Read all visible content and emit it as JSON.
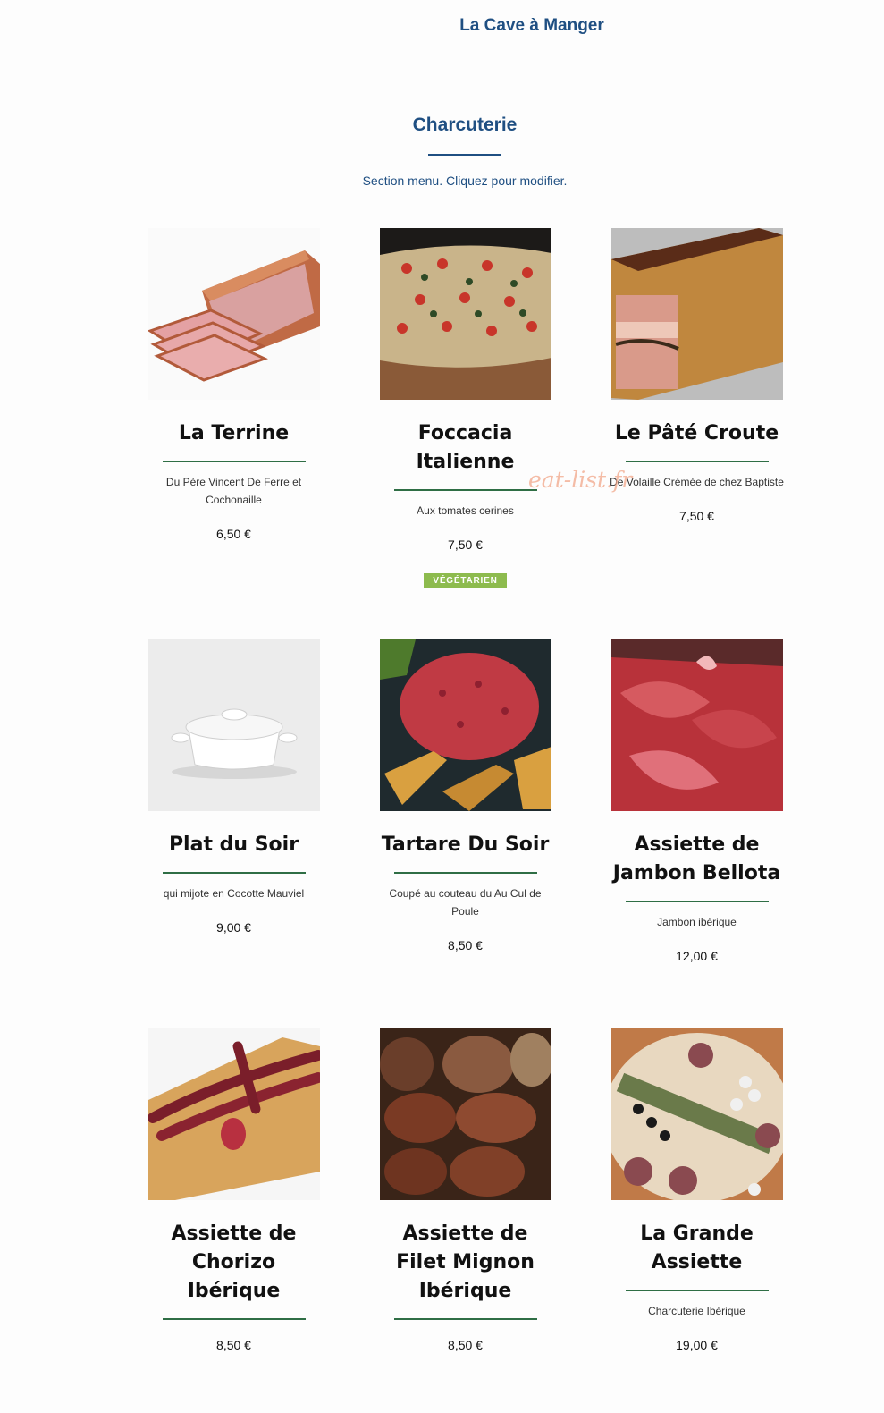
{
  "header": {
    "restaurant_name": "La Cave à Manger"
  },
  "section": {
    "title": "Charcuterie",
    "description": "Section menu. Cliquez pour modifier."
  },
  "items": [
    {
      "name": "La Terrine",
      "description": "Du Père Vincent De Ferre et Cochonaille",
      "price": "6,50 €",
      "photo_icon": "sliced-ham-icon"
    },
    {
      "name": "Foccacia Italienne",
      "description": "Aux tomates cerines",
      "price": "7,50 €",
      "badge": "VÉGÉTARIEN",
      "photo_icon": "focaccia-icon"
    },
    {
      "name": "Le Pâté Croute",
      "description": "De Volaille Crémée de chez Baptiste",
      "price": "7,50 €",
      "photo_icon": "pate-croute-icon"
    },
    {
      "name": "Plat du Soir",
      "description": "qui mijote en Cocotte Mauviel",
      "price": "9,00 €",
      "photo_icon": "cocotte-icon"
    },
    {
      "name": "Tartare Du Soir",
      "description": "Coupé au couteau du Au Cul de Poule",
      "price": "8,50 €",
      "photo_icon": "tartare-icon"
    },
    {
      "name": "Assiette de Jambon Bellota",
      "description": "Jambon ibérique",
      "price": "12,00 €",
      "photo_icon": "jambon-icon"
    },
    {
      "name": "Assiette de Chorizo Ibérique",
      "description": "",
      "price": "8,50 €",
      "photo_icon": "chorizo-icon"
    },
    {
      "name": "Assiette de Filet Mignon Ibérique",
      "description": "",
      "price": "8,50 €",
      "photo_icon": "filet-mignon-icon"
    },
    {
      "name": "La Grande Assiette",
      "description": "Charcuterie Ibérique",
      "price": "19,00 €",
      "photo_icon": "grande-assiette-icon"
    }
  ],
  "watermark": "eat-list.fr",
  "colors": {
    "accent_blue": "#1f4f82",
    "rule_green": "#2f6e45",
    "badge_green": "#8dbb4e"
  }
}
